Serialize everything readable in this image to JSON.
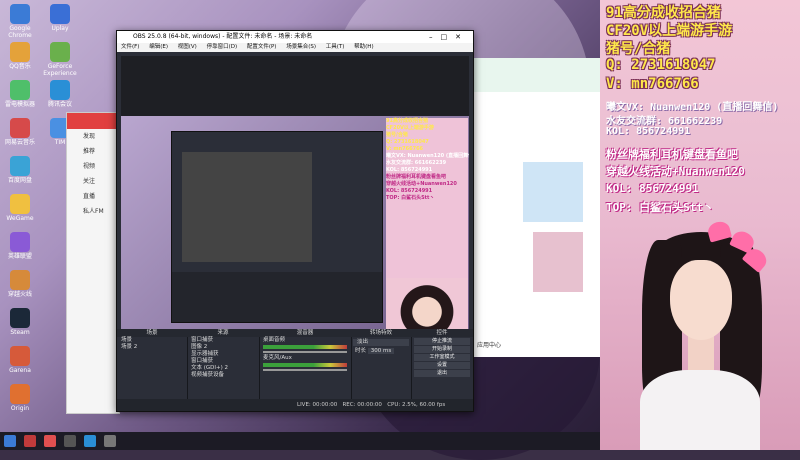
{
  "obs": {
    "title": "OBS 25.0.8 (64-bit, windows) - 配置文件: 未命名 - 场景: 未命名",
    "menu": [
      "文件(F)",
      "编辑(E)",
      "视图(V)",
      "停靠窗口(D)",
      "配置文件(P)",
      "场景集合(S)",
      "工具(T)",
      "帮助(H)"
    ],
    "docks": {
      "scenes": {
        "header": "场景",
        "items": [
          "场景",
          "场景 2"
        ]
      },
      "sources": {
        "header": "来源",
        "items": [
          "窗口捕获",
          "图像 2",
          "显示器捕获",
          "窗口捕获",
          "文本 (GDI+) 2",
          "视频捕获设备"
        ]
      },
      "mixer": {
        "header": "混音器",
        "tracks": [
          "桌面音频",
          "麦克风/Aux"
        ]
      },
      "transitions": {
        "header": "转场特效",
        "type": "淡出",
        "duration_label": "时长",
        "duration": "300 ms"
      },
      "controls": {
        "header": "控件",
        "buttons": [
          "停止推流",
          "开始录制",
          "工作室模式",
          "设置",
          "退出"
        ]
      }
    },
    "status": {
      "live": "LIVE: 00:00:00",
      "rec": "REC: 00:00:00",
      "cpu": "CPU: 2.5%, 60.00 fps"
    }
  },
  "browser": {
    "nav": [
      "发现",
      "推荐",
      "视频",
      "关注",
      "直播",
      "私人FM"
    ]
  },
  "overlay": {
    "lines": [
      {
        "text": "91高分成收招合猪",
        "style": "big"
      },
      {
        "text": "CF20V以上端游手游",
        "style": "big"
      },
      {
        "text": "猪号/合猪",
        "style": "big"
      },
      {
        "text": "Q: 2731618047",
        "style": "big"
      },
      {
        "text": "V: mn766766",
        "style": "big"
      },
      {
        "text": "曦文VX: Nuanwen120 (直播回舞信)",
        "style": "small"
      },
      {
        "text": "水友交流群: 661662239",
        "style": "small"
      },
      {
        "text": "KOL: 856724991",
        "style": "small"
      },
      {
        "text": "粉丝牌福利耳机键盘看鱼吧",
        "style": "mag"
      },
      {
        "text": "穿越火线活动+Nuanwen120",
        "style": "mag"
      },
      {
        "text": "KOL: 856724991",
        "style": "mag"
      },
      {
        "text": "TOP: 白鲨石头Stt丶",
        "style": "mag"
      }
    ]
  },
  "desktop": {
    "icons": [
      "Google Chrome",
      "QQ音乐",
      "雷电模拟器",
      "网易云音乐",
      "百度网盘",
      "WeGame",
      "英雄联盟",
      "穿越火线",
      "Steam",
      "Garena",
      "Origin",
      "Uplay",
      "GeForce Experience",
      "腾讯会议",
      "TIM"
    ]
  },
  "chat": {
    "bottom_label": "应用中心"
  },
  "colors": {
    "overlay_yellow": "#ffe84a",
    "overlay_pink": "#c02a86",
    "obs_dark": "#2b2e38"
  }
}
